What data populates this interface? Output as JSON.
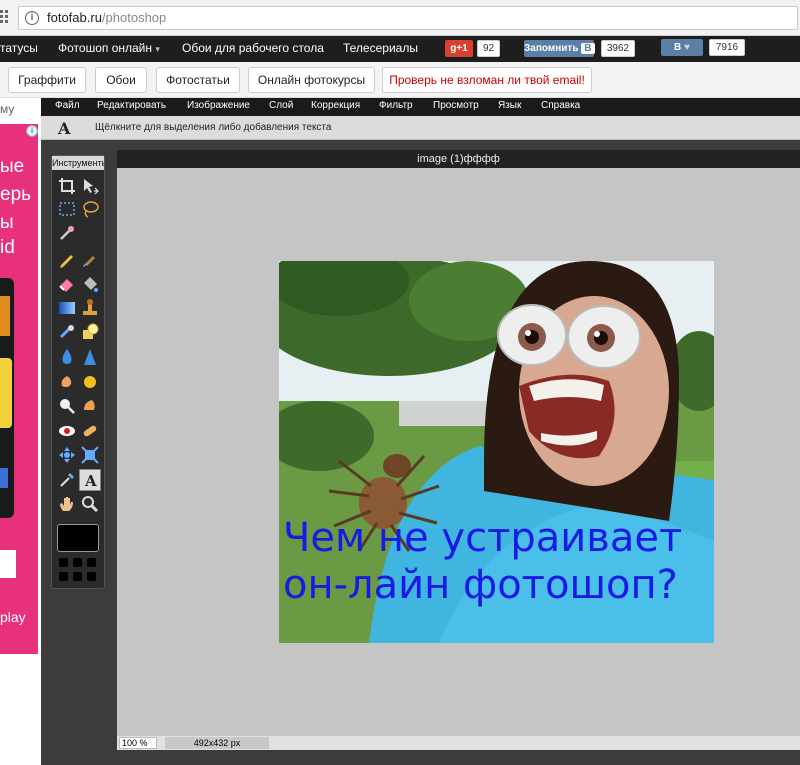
{
  "browser": {
    "url_host": "fotofab.ru",
    "url_path": "/photoshop"
  },
  "site_nav": {
    "items": [
      "татусы",
      "Фотошоп онлайн",
      "Обои для рабочего стола",
      "Телесериалы"
    ],
    "gplus_label": "+1",
    "gplus_count": "92",
    "vk_remember_label": "Запомнить",
    "vk_remember_count": "3962",
    "vk_like_count": "7916"
  },
  "site_sub": {
    "buttons": [
      "Граффити",
      "Обои",
      "Фотостатьи",
      "Онлайн фотокурсы"
    ],
    "email_check": "Проверь не взломан ли твой email!"
  },
  "ad": {
    "lines": [
      "му",
      "ые",
      "ерь",
      "ы",
      "id",
      "play"
    ]
  },
  "editor": {
    "menu": [
      "Файл",
      "Редактировать",
      "Изображение",
      "Слой",
      "Коррекция",
      "Фильтр",
      "Просмотр",
      "Язык",
      "Справка"
    ],
    "text_tool_glyph": "A",
    "text_tool_hint": "Щёлкните для выделения либо добавления текста",
    "toolbox_title": "Инструменты",
    "doc_title": "image (1)фффф",
    "zoom": "100 %",
    "image_size": "492x432 px",
    "caption_line1": "Чем не устраивает",
    "caption_line2": "он-лайн фотошоп?"
  },
  "colors": {
    "caption": "#1a1ae6",
    "ad_pink": "#e8317c",
    "email_button_text": "#cc0000"
  }
}
